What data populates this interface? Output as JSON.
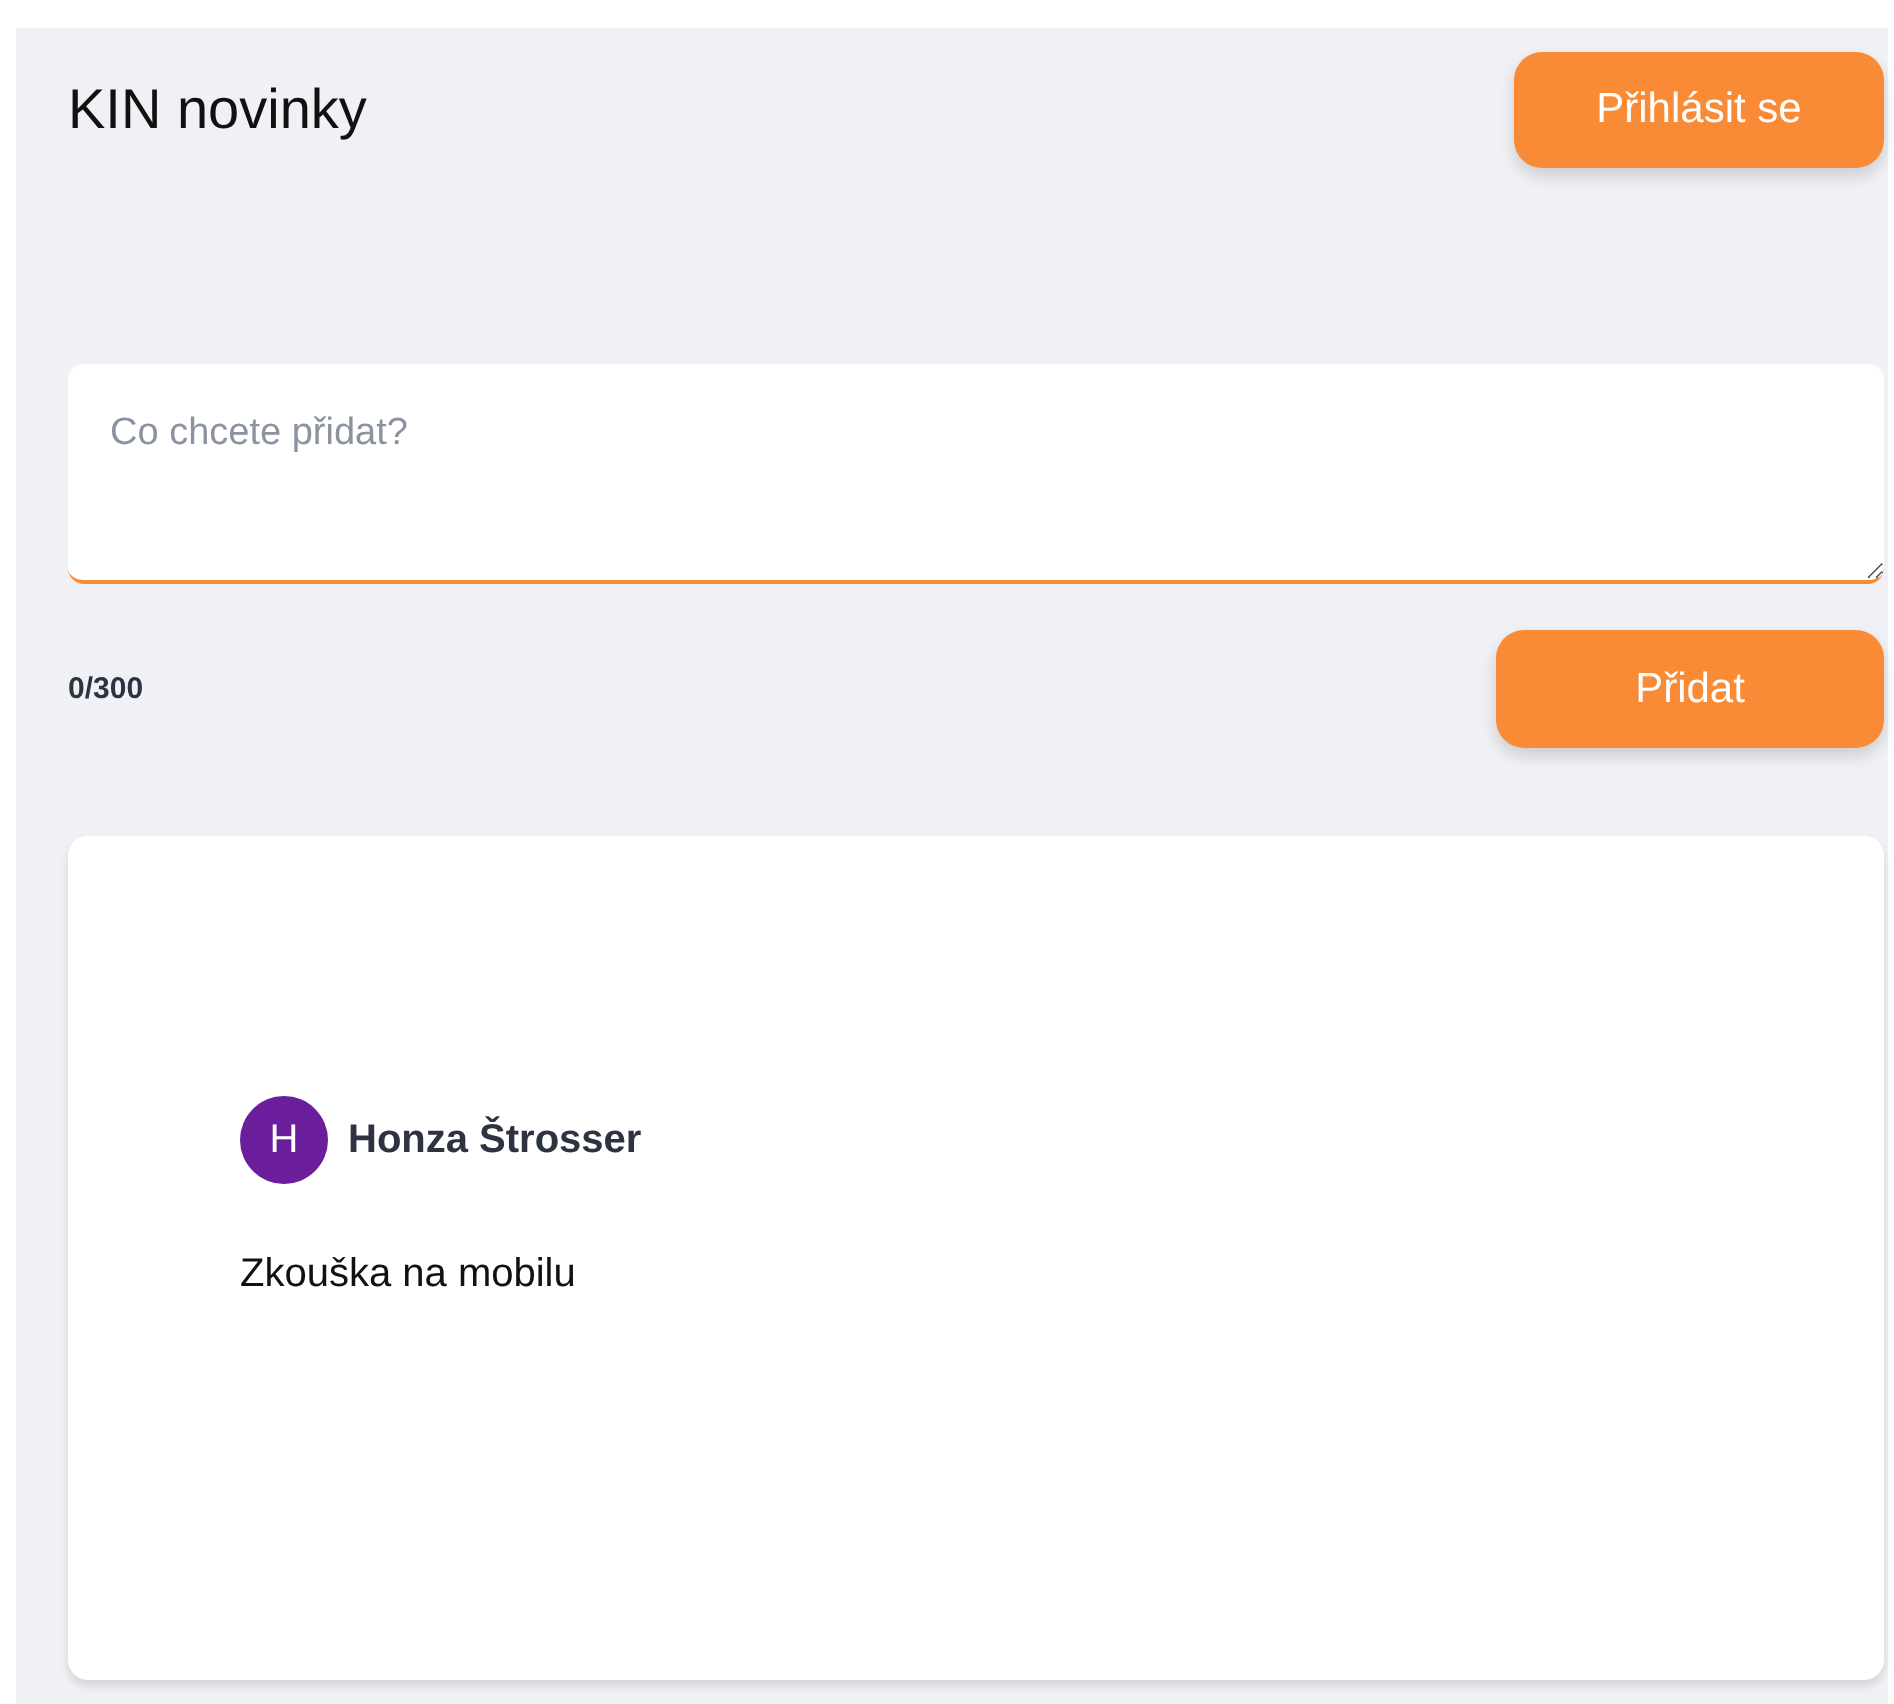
{
  "header": {
    "title": "KIN novinky",
    "login_button": "Přihlásit se"
  },
  "composer": {
    "placeholder": "Co chcete přidat?",
    "counter": "0/300",
    "submit_button": "Přidat"
  },
  "posts": [
    {
      "avatar_letter": "H",
      "author": "Honza Štrosser",
      "text": "Zkouška na mobilu"
    }
  ]
}
